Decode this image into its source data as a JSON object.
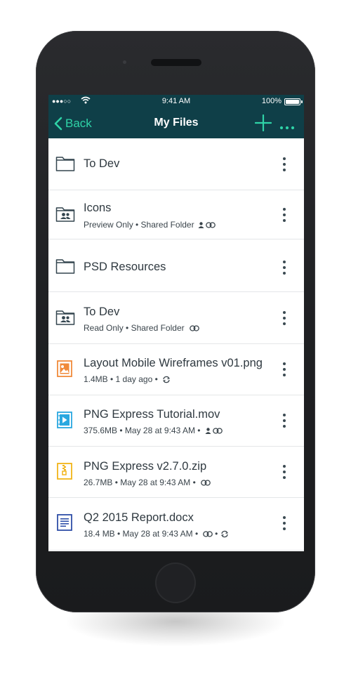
{
  "status_bar": {
    "signal": "●●●○○",
    "time": "9:41 AM",
    "battery_text": "100%",
    "battery_level": 1.0
  },
  "nav": {
    "back_label": "Back",
    "title": "My Files",
    "accent_color": "#2fd3a7",
    "bar_color": "#0f3f48"
  },
  "files": [
    {
      "icon": "folder-icon",
      "title": "To Dev",
      "meta": ""
    },
    {
      "icon": "shared-folder-icon",
      "title": "Icons",
      "meta": "Preview Only • Shared Folder",
      "meta_icons": [
        "person-icon",
        "link-icon"
      ]
    },
    {
      "icon": "folder-icon",
      "title": "PSD Resources",
      "meta": ""
    },
    {
      "icon": "shared-folder-icon",
      "title": "To Dev",
      "meta": "Read Only • Shared Folder",
      "meta_icons": [
        "link-icon"
      ]
    },
    {
      "icon": "image-file-icon",
      "title": "Layout Mobile Wireframes v01.png",
      "meta": "1.4MB • 1 day ago •",
      "meta_icons": [
        "sync-icon"
      ],
      "color": "#f08a3a"
    },
    {
      "icon": "video-file-icon",
      "title": "PNG Express Tutorial.mov",
      "meta": "375.6MB • May 28 at 9:43 AM •",
      "meta_icons": [
        "person-icon",
        "link-icon"
      ],
      "color": "#2aa8e0"
    },
    {
      "icon": "zip-file-icon",
      "title": "PNG Express v2.7.0.zip",
      "meta": "26.7MB • May 28 at 9:43 AM •",
      "meta_icons": [
        "link-icon"
      ],
      "color": "#f2b418"
    },
    {
      "icon": "document-file-icon",
      "title": "Q2 2015 Report.docx",
      "meta": "18.4 MB • May 28 at 9:43 AM •",
      "meta_icons": [
        "link-icon",
        "bullet",
        "sync-icon"
      ],
      "color": "#2f4fa8"
    }
  ]
}
